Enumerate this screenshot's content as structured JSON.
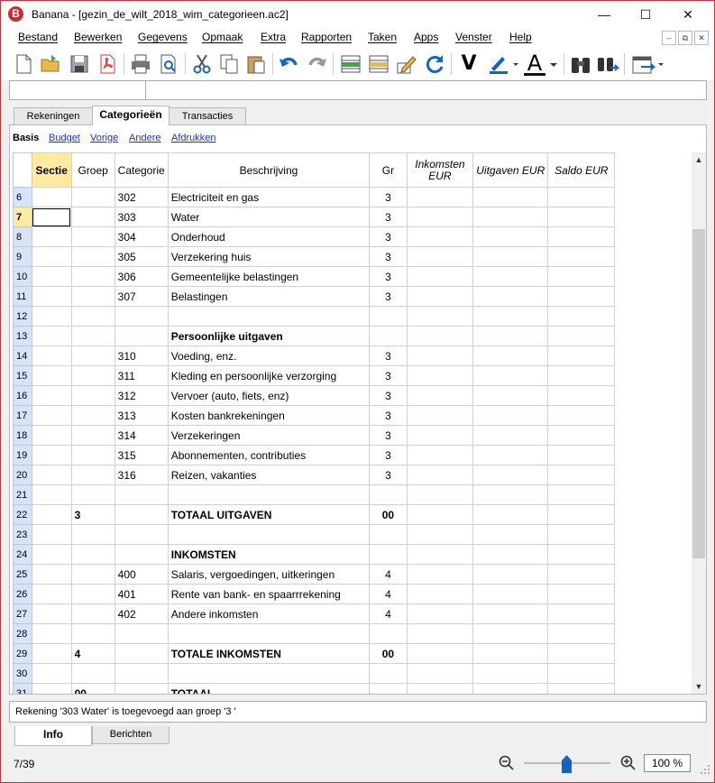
{
  "window": {
    "title": "Banana - [gezin_de_wilt_2018_wim_categorieen.ac2]",
    "logo_text": "B",
    "min": "—",
    "max": "☐",
    "close": "✕"
  },
  "menu": [
    "Bestand",
    "Bewerken",
    "Gegevens",
    "Opmaak",
    "Extra",
    "Rapporten",
    "Taken",
    "Apps",
    "Venster",
    "Help"
  ],
  "mdi": {
    "min": "–",
    "restore": "⧉",
    "close": "✕"
  },
  "toolbar": {
    "icons": [
      "new-file-icon",
      "open-folder-icon",
      "save-icon",
      "pdf-icon",
      "print-icon",
      "print-preview-icon",
      "cut-icon",
      "copy-icon",
      "paste-icon",
      "undo-icon",
      "redo-icon",
      "add-rows-icon",
      "delete-rows-icon",
      "edit-pencil-icon",
      "refresh-icon",
      "checkmark-v-icon",
      "highlighter-icon",
      "font-color-icon",
      "binoculars-icon",
      "find-replace-icon",
      "window-export-icon"
    ],
    "v_label": "V",
    "a_label": "A"
  },
  "colors": {
    "accent_yellow": "#ffeaa0",
    "rownum_blue": "#d6e4f5",
    "link_blue": "#1a33cc",
    "title_red": "#d8262f",
    "undo_blue": "#1565c0"
  },
  "tabs": [
    "Rekeningen",
    "Categorieën",
    "Transacties"
  ],
  "subviews": [
    "Basis",
    "Budget",
    "Vorige",
    "Andere",
    "Afdrukken"
  ],
  "table": {
    "headers": [
      "Sectie",
      "Groep",
      "Categorie",
      "Beschrijving",
      "Gr",
      "Inkomsten EUR",
      "Uitgaven EUR",
      "Saldo EUR"
    ],
    "rows": [
      {
        "n": "6",
        "sectie": "",
        "groep": "",
        "cat": "302",
        "desc": "Electriciteit en gas",
        "gr": "3"
      },
      {
        "n": "7",
        "sectie": "",
        "groep": "",
        "cat": "303",
        "desc": "Water",
        "gr": "3"
      },
      {
        "n": "8",
        "sectie": "",
        "groep": "",
        "cat": "304",
        "desc": "Onderhoud",
        "gr": "3"
      },
      {
        "n": "9",
        "sectie": "",
        "groep": "",
        "cat": "305",
        "desc": "Verzekering huis",
        "gr": "3"
      },
      {
        "n": "10",
        "sectie": "",
        "groep": "",
        "cat": "306",
        "desc": "Gemeentelijke belastingen",
        "gr": "3"
      },
      {
        "n": "11",
        "sectie": "",
        "groep": "",
        "cat": "307",
        "desc": "Belastingen",
        "gr": "3"
      },
      {
        "n": "12",
        "sectie": "",
        "groep": "",
        "cat": "",
        "desc": "",
        "gr": ""
      },
      {
        "n": "13",
        "sectie": "",
        "groep": "",
        "cat": "",
        "desc": "Persoonlijke uitgaven",
        "gr": "",
        "bold": true
      },
      {
        "n": "14",
        "sectie": "",
        "groep": "",
        "cat": "310",
        "desc": "Voeding, enz.",
        "gr": "3"
      },
      {
        "n": "15",
        "sectie": "",
        "groep": "",
        "cat": "311",
        "desc": "Kleding en persoonlijke verzorging",
        "gr": "3"
      },
      {
        "n": "16",
        "sectie": "",
        "groep": "",
        "cat": "312",
        "desc": "Vervoer (auto, fiets, enz)",
        "gr": "3"
      },
      {
        "n": "17",
        "sectie": "",
        "groep": "",
        "cat": "313",
        "desc": "Kosten bankrekeningen",
        "gr": "3"
      },
      {
        "n": "18",
        "sectie": "",
        "groep": "",
        "cat": "314",
        "desc": "Verzekeringen",
        "gr": "3"
      },
      {
        "n": "19",
        "sectie": "",
        "groep": "",
        "cat": "315",
        "desc": "Abonnementen, contributies",
        "gr": "3"
      },
      {
        "n": "20",
        "sectie": "",
        "groep": "",
        "cat": "316",
        "desc": "Reizen, vakanties",
        "gr": "3"
      },
      {
        "n": "21",
        "sectie": "",
        "groep": "",
        "cat": "",
        "desc": "",
        "gr": ""
      },
      {
        "n": "22",
        "sectie": "",
        "groep": "3",
        "cat": "",
        "desc": "TOTAAL UITGAVEN",
        "gr": "00",
        "bold": true
      },
      {
        "n": "23",
        "sectie": "",
        "groep": "",
        "cat": "",
        "desc": "",
        "gr": ""
      },
      {
        "n": "24",
        "sectie": "",
        "groep": "",
        "cat": "",
        "desc": "INKOMSTEN",
        "gr": "",
        "bold": true
      },
      {
        "n": "25",
        "sectie": "",
        "groep": "",
        "cat": "400",
        "desc": "Salaris, vergoedingen, uitkeringen",
        "gr": "4"
      },
      {
        "n": "26",
        "sectie": "",
        "groep": "",
        "cat": "401",
        "desc": "Rente van bank- en spaarrrekening",
        "gr": "4"
      },
      {
        "n": "27",
        "sectie": "",
        "groep": "",
        "cat": "402",
        "desc": "Andere inkomsten",
        "gr": "4"
      },
      {
        "n": "28",
        "sectie": "",
        "groep": "",
        "cat": "",
        "desc": "",
        "gr": ""
      },
      {
        "n": "29",
        "sectie": "",
        "groep": "4",
        "cat": "",
        "desc": "TOTALE INKOMSTEN",
        "gr": "00",
        "bold": true
      },
      {
        "n": "30",
        "sectie": "",
        "groep": "",
        "cat": "",
        "desc": "",
        "gr": ""
      },
      {
        "n": "31",
        "sectie": "",
        "groep": "00",
        "cat": "",
        "desc": "TOTAAL",
        "gr": "",
        "bold": true
      }
    ]
  },
  "message": "Rekening '303 Water' is toegevoegd aan groep '3 '",
  "bottom_tabs": [
    "Info",
    "Berichten"
  ],
  "status": {
    "position": "7/39",
    "zoom": "100 %"
  }
}
